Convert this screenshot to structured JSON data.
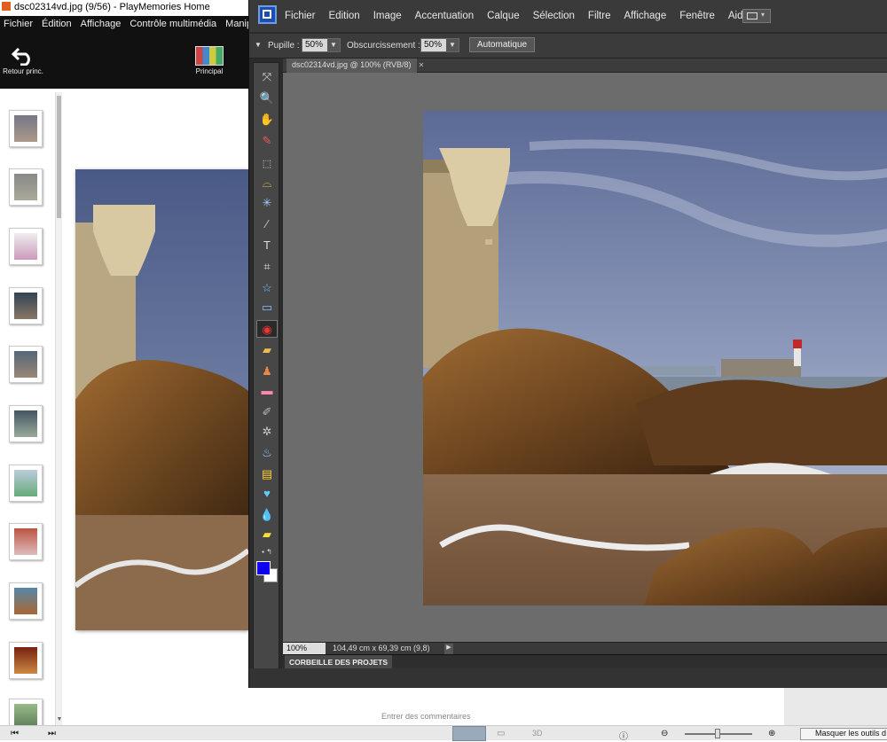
{
  "playmemories": {
    "title": "dsc02314vd.jpg (9/56) - PlayMemories Home",
    "menu": [
      "Fichier",
      "Édition",
      "Affichage",
      "Contrôle multimédia",
      "Manip"
    ],
    "back_label": "Retour princ.",
    "main_label": "Principal",
    "comments_placeholder": "Entrer des commentaires",
    "mask_tools_label": "Masquer les outils d",
    "view_3d_label": "3D",
    "thumbnail_count_visible": 11
  },
  "pse": {
    "menu": [
      "Fichier",
      "Edition",
      "Image",
      "Accentuation",
      "Calque",
      "Sélection",
      "Filtre",
      "Affichage",
      "Fenêtre",
      "Aide"
    ],
    "options": {
      "pupil_label": "Pupille :",
      "pupil_value": "50%",
      "darken_label": "Obscurcissement :",
      "darken_value": "50%",
      "auto_label": "Automatique"
    },
    "document": {
      "tab": "dsc02314vd.jpg @ 100% (RVB/8)",
      "zoom": "100%",
      "dimensions": "104,49 cm x 69,39 cm (9,8)"
    },
    "project_bin": "CORBEILLE DES PROJETS",
    "colors": {
      "foreground": "#1000f0",
      "background": "#ffffff"
    }
  }
}
